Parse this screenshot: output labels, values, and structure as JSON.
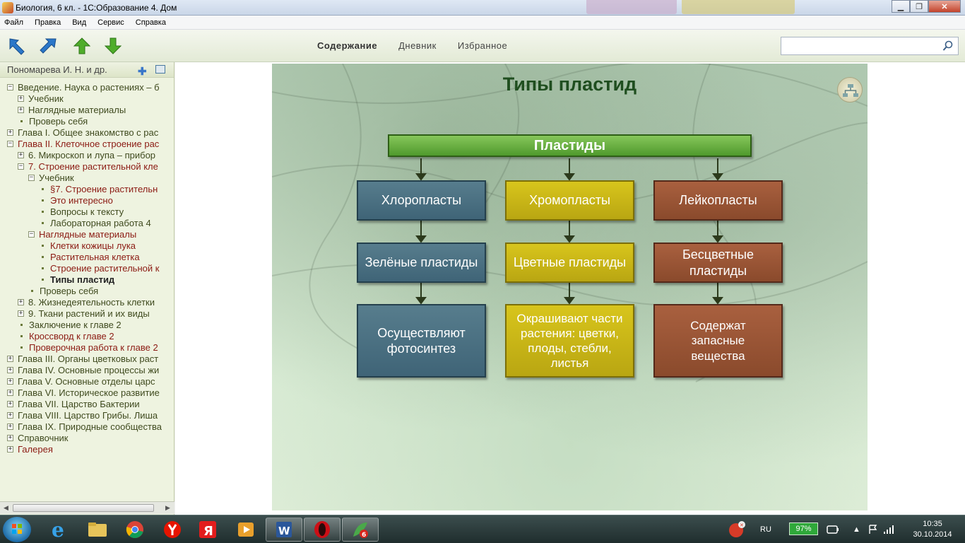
{
  "window": {
    "title": "Биология, 6 кл. - 1С:Образование 4. Дом"
  },
  "menu": [
    "Файл",
    "Правка",
    "Вид",
    "Сервис",
    "Справка"
  ],
  "toolbar": {
    "tabs": [
      {
        "label": "Содержание",
        "active": true
      },
      {
        "label": "Дневник",
        "active": false
      },
      {
        "label": "Избранное",
        "active": false
      }
    ],
    "search_value": ""
  },
  "sidebar": {
    "header": "Пономарева И. Н. и др.",
    "tree": [
      {
        "level": 0,
        "toggle": "⊟",
        "label": "Введение. Наука о растениях – б"
      },
      {
        "level": 1,
        "toggle": "⊞",
        "label": "Учебник"
      },
      {
        "level": 1,
        "toggle": "⊞",
        "label": "Наглядные материалы"
      },
      {
        "level": 1,
        "toggle": "•",
        "label": "Проверь себя"
      },
      {
        "level": 0,
        "toggle": "⊞",
        "label": "Глава I. Общее знакомство с рас"
      },
      {
        "level": 0,
        "toggle": "⊟",
        "label": "Глава II. Клеточное строение рас",
        "style": "red"
      },
      {
        "level": 1,
        "toggle": "⊞",
        "label": "6. Микроскоп и лупа – прибор"
      },
      {
        "level": 1,
        "toggle": "⊟",
        "label": "7. Строение растительной кле",
        "style": "red"
      },
      {
        "level": 2,
        "toggle": "⊟",
        "label": "Учебник"
      },
      {
        "level": 3,
        "toggle": "•",
        "label": "§7. Строение растительн",
        "style": "red"
      },
      {
        "level": 3,
        "toggle": "•",
        "label": "Это интересно",
        "style": "red"
      },
      {
        "level": 3,
        "toggle": "•",
        "label": "Вопросы к тексту"
      },
      {
        "level": 3,
        "toggle": "•",
        "label": "Лабораторная работа 4"
      },
      {
        "level": 2,
        "toggle": "⊟",
        "label": "Наглядные материалы",
        "style": "red"
      },
      {
        "level": 3,
        "toggle": "•",
        "label": "Клетки кожицы лука",
        "style": "red"
      },
      {
        "level": 3,
        "toggle": "•",
        "label": "Растительная клетка",
        "style": "red"
      },
      {
        "level": 3,
        "toggle": "•",
        "label": "Строение растительной к",
        "style": "red"
      },
      {
        "level": 3,
        "toggle": "•",
        "label": "Типы пластид",
        "style": "bold"
      },
      {
        "level": 2,
        "toggle": "•",
        "label": "Проверь себя"
      },
      {
        "level": 1,
        "toggle": "⊞",
        "label": "8. Жизнедеятельность клетки"
      },
      {
        "level": 1,
        "toggle": "⊞",
        "label": "9. Ткани растений и их виды"
      },
      {
        "level": 1,
        "toggle": "•",
        "label": "Заключение к главе 2"
      },
      {
        "level": 1,
        "toggle": "•",
        "label": "Кроссворд к главе 2",
        "style": "red"
      },
      {
        "level": 1,
        "toggle": "•",
        "label": "Проверочная работа к главе 2",
        "style": "red"
      },
      {
        "level": 0,
        "toggle": "⊞",
        "label": "Глава III. Органы цветковых раст"
      },
      {
        "level": 0,
        "toggle": "⊞",
        "label": "Глава IV. Основные процессы жи"
      },
      {
        "level": 0,
        "toggle": "⊞",
        "label": "Глава V. Основные отделы царс"
      },
      {
        "level": 0,
        "toggle": "⊞",
        "label": "Глава VI. Историческое развитие"
      },
      {
        "level": 0,
        "toggle": "⊞",
        "label": "Глава VII. Царство Бактерии"
      },
      {
        "level": 0,
        "toggle": "⊞",
        "label": "Глава VIII. Царство Грибы. Лиша"
      },
      {
        "level": 0,
        "toggle": "⊞",
        "label": "Глава IX. Природные сообщества"
      },
      {
        "level": 0,
        "toggle": "⊞",
        "label": "Справочник"
      },
      {
        "level": 0,
        "toggle": "⊞",
        "label": "Галерея",
        "style": "red"
      }
    ]
  },
  "slide": {
    "title": "Типы пластид",
    "root": "Пластиды",
    "columns": [
      {
        "name": "Хлоропласты",
        "mid": "Зелёные пластиды",
        "bottom": "Осуществляют фотосинтез",
        "color": "blue"
      },
      {
        "name": "Хромопласты",
        "mid": "Цветные пластиды",
        "bottom": "Окрашивают части растения: цветки, плоды, стебли, листья",
        "color": "yellow"
      },
      {
        "name": "Лейкопласты",
        "mid": "Бесцветные пластиды",
        "bottom": "Содержат запасные вещества",
        "color": "brown"
      }
    ]
  },
  "taskbar": {
    "lang": "RU",
    "battery": "97%",
    "time": "10:35",
    "date": "30.10.2014"
  }
}
